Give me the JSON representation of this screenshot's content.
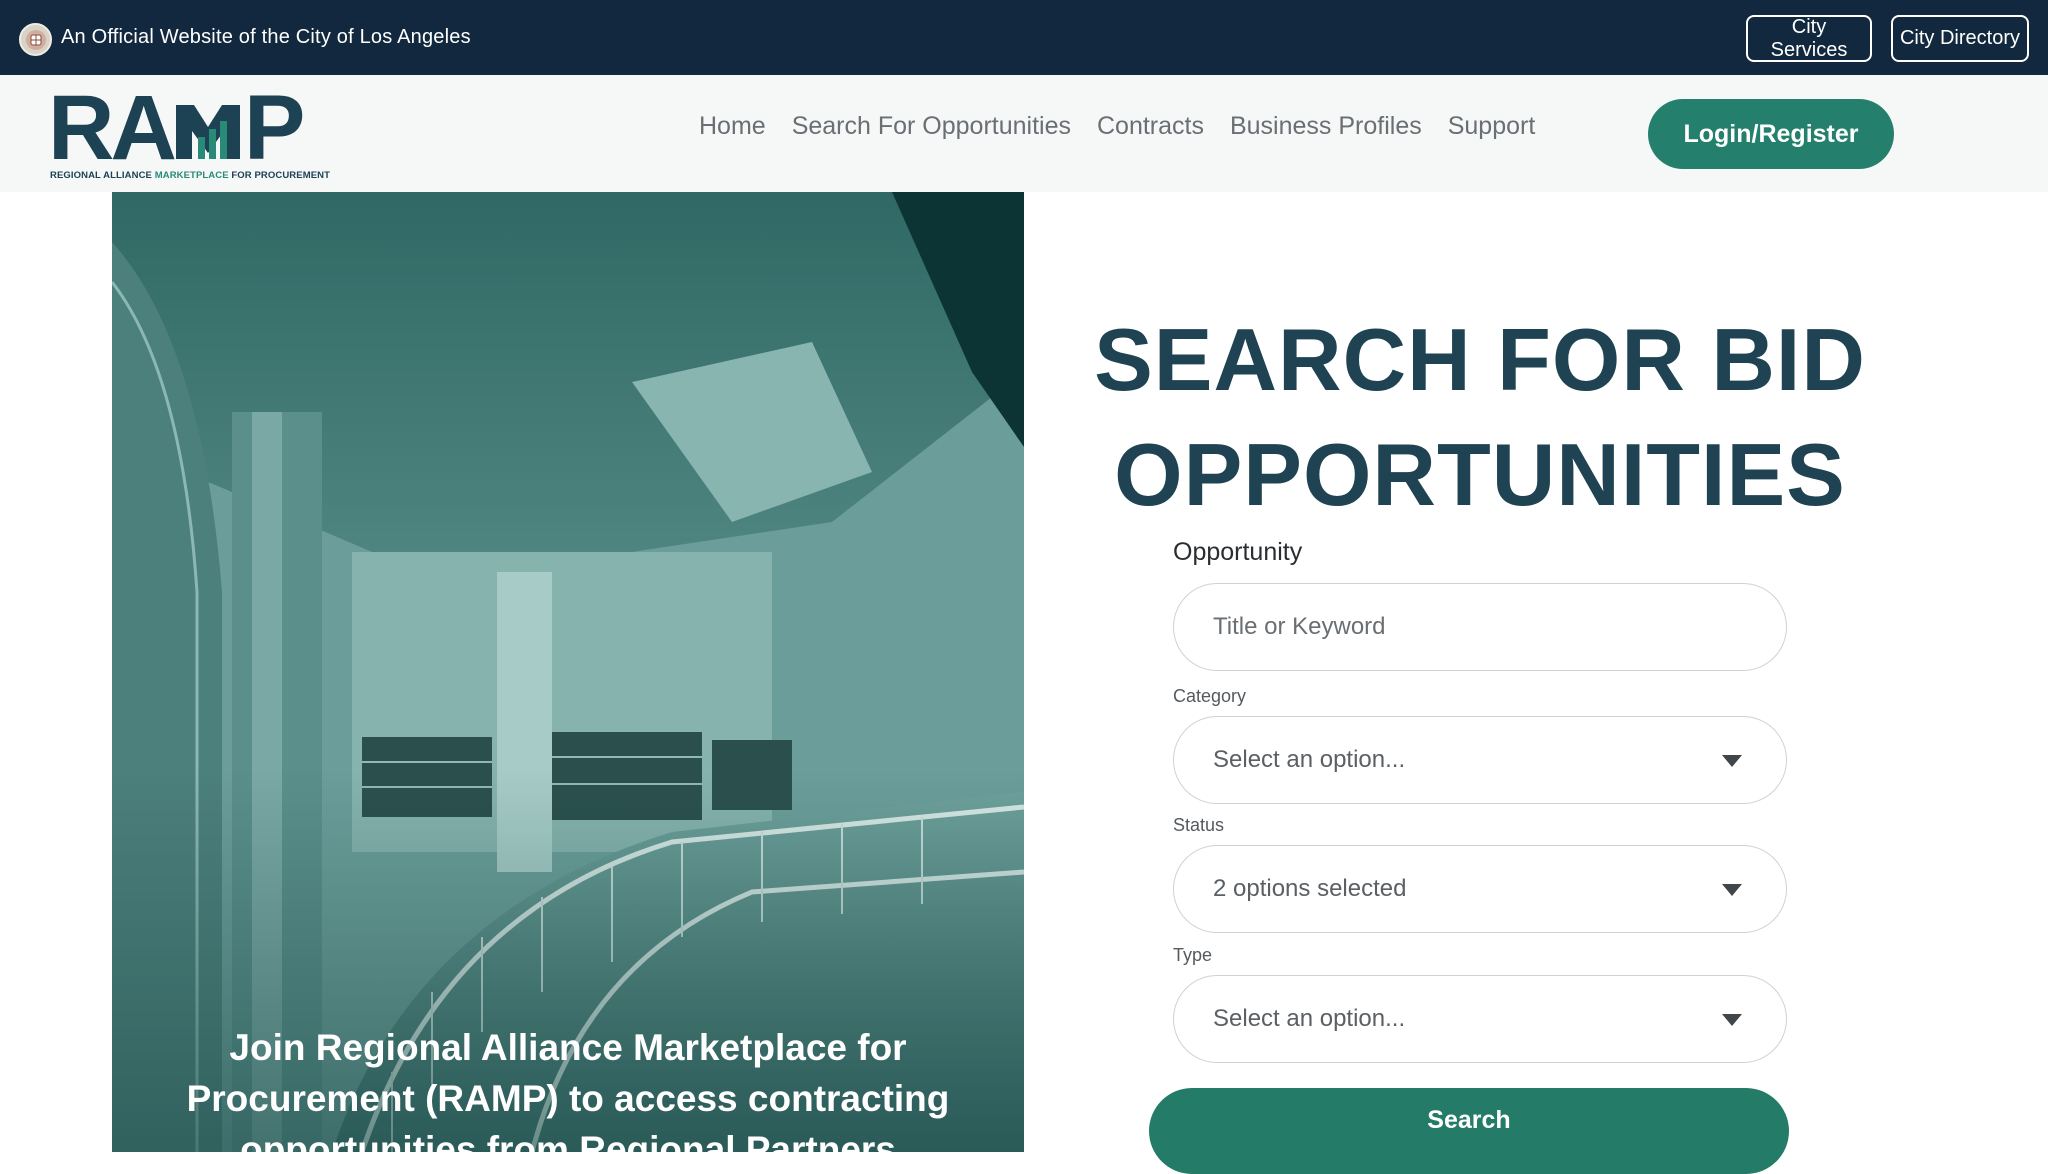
{
  "official_bar": {
    "text": "An Official Website of the City of Los Angeles",
    "seal_icon": "city-seal-icon",
    "city_services": "City Services",
    "city_directory": "City Directory"
  },
  "logo": {
    "wordmark": "RAMP",
    "tagline_start": "REGIONAL ALLIANCE ",
    "tagline_accent": "MARKETPLACE",
    "tagline_end": " FOR PROCUREMENT"
  },
  "nav": {
    "items": [
      {
        "label": "Home"
      },
      {
        "label": "Search For Opportunities"
      },
      {
        "label": "Contracts"
      },
      {
        "label": "Business Profiles"
      },
      {
        "label": "Support"
      }
    ],
    "login": "Login/Register"
  },
  "hero": {
    "caption": "Join Regional Alliance Marketplace for Procurement (RAMP) to access contracting opportunities from Regional Partners"
  },
  "search": {
    "title_line1": "SEARCH FOR BID",
    "title_line2": "OPPORTUNITIES",
    "opportunity_label": "Opportunity",
    "opportunity_placeholder": "Title or Keyword",
    "category_label": "Category",
    "category_value": "Select an option...",
    "status_label": "Status",
    "status_value": "2 options selected",
    "type_label": "Type",
    "type_value": "Select an option...",
    "submit": "Search"
  },
  "colors": {
    "top_bar": "#12283e",
    "brand_dark": "#1c4254",
    "brand_green": "#24806c",
    "title": "#1f4352"
  }
}
